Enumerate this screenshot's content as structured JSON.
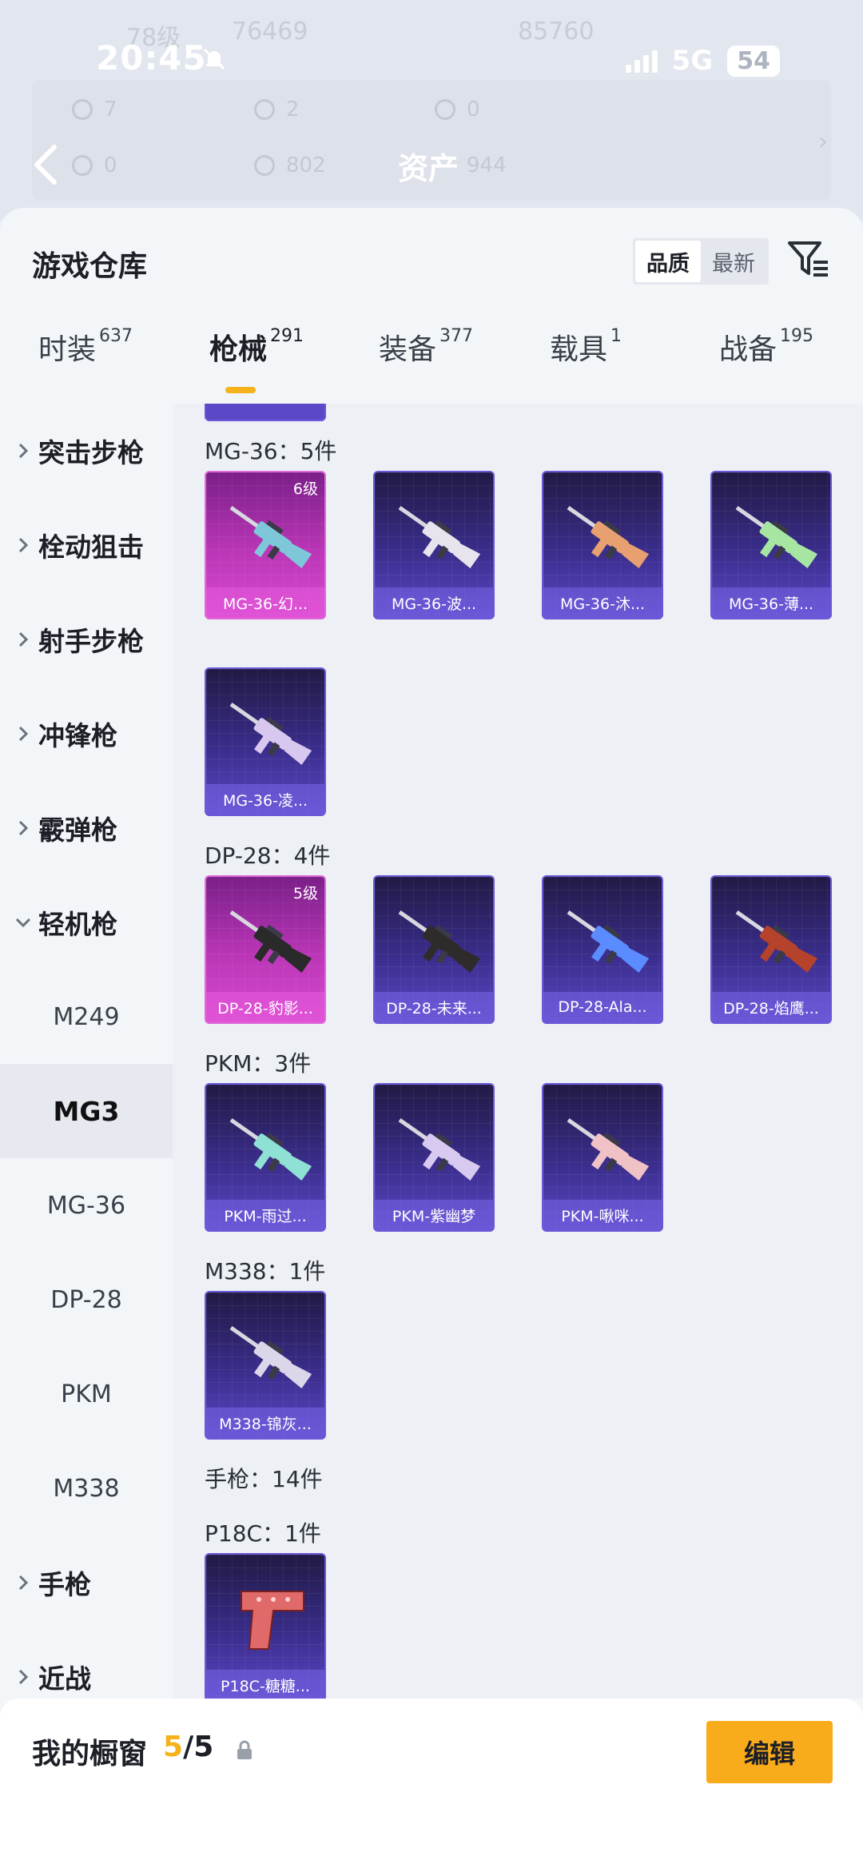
{
  "status_bar": {
    "time": "20:45",
    "network": "5G",
    "battery": "54"
  },
  "background": {
    "level": "78级",
    "coins": "76469",
    "score": "85760",
    "stats_row1": [
      "7",
      "2",
      "0"
    ],
    "stats_row2": [
      "0",
      "802",
      "944"
    ],
    "asset_label": "资产"
  },
  "sheet": {
    "title": "游戏仓库",
    "sort_options": [
      "品质",
      "最新"
    ],
    "active_sort": "品质"
  },
  "tabs": [
    {
      "label": "时装",
      "count": "637"
    },
    {
      "label": "枪械",
      "count": "291",
      "active": true
    },
    {
      "label": "装备",
      "count": "377"
    },
    {
      "label": "载具",
      "count": "1"
    },
    {
      "label": "战备",
      "count": "195"
    }
  ],
  "categories": {
    "main": [
      "突击步枪",
      "栓动狙击",
      "射手步枪",
      "冲锋枪",
      "霰弹枪",
      "轻机枪"
    ],
    "lmg_sub": [
      "M249",
      "MG3",
      "MG-36",
      "DP-28",
      "PKM",
      "M338"
    ],
    "active_sub": "MG3",
    "after": [
      "手枪",
      "近战"
    ]
  },
  "sections": [
    {
      "title": "MG-36：5件",
      "items": [
        {
          "name": "MG-36-幻...",
          "level": "6级",
          "rarity": "pink",
          "color": "#7ec7d8"
        },
        {
          "name": "MG-36-波...",
          "rarity": "purple",
          "color": "#e8e4ee"
        },
        {
          "name": "MG-36-沐...",
          "rarity": "purple",
          "color": "#e9a070"
        },
        {
          "name": "MG-36-薄...",
          "rarity": "purple",
          "color": "#a7e6a2"
        },
        {
          "name": "MG-36-凌...",
          "rarity": "purple",
          "color": "#d8c8f0"
        }
      ]
    },
    {
      "title": "DP-28：4件",
      "items": [
        {
          "name": "DP-28-豹影...",
          "level": "5级",
          "rarity": "pink",
          "color": "#2a2a2a"
        },
        {
          "name": "DP-28-未来...",
          "rarity": "purple",
          "color": "#2f2b2b"
        },
        {
          "name": "DP-28-Ala...",
          "rarity": "purple",
          "color": "#5b8cff"
        },
        {
          "name": "DP-28-焰鹰...",
          "rarity": "purple",
          "color": "#b5432b"
        }
      ]
    },
    {
      "title": "PKM：3件",
      "items": [
        {
          "name": "PKM-雨过...",
          "rarity": "purple",
          "color": "#8fe0d5"
        },
        {
          "name": "PKM-紫幽梦",
          "rarity": "purple",
          "color": "#d7c9f0"
        },
        {
          "name": "PKM-啾咪...",
          "rarity": "purple",
          "color": "#f0c2c6"
        }
      ]
    },
    {
      "title": "M338：1件",
      "items": [
        {
          "name": "M338-锦灰...",
          "rarity": "purple",
          "color": "#dcd6ea"
        }
      ]
    },
    {
      "title": "手枪：14件",
      "items": []
    },
    {
      "title": "P18C：1件",
      "items": [
        {
          "name": "P18C-糖糖...",
          "rarity": "purple",
          "color": "#e06a6a"
        }
      ]
    }
  ],
  "bottom_bar": {
    "label": "我的橱窗",
    "current": "5",
    "total": "/5",
    "edit_label": "编辑"
  },
  "colors": {
    "accent": "#f8ab1b",
    "epic": "#5a48c6",
    "legendary": "#c23ac0"
  }
}
